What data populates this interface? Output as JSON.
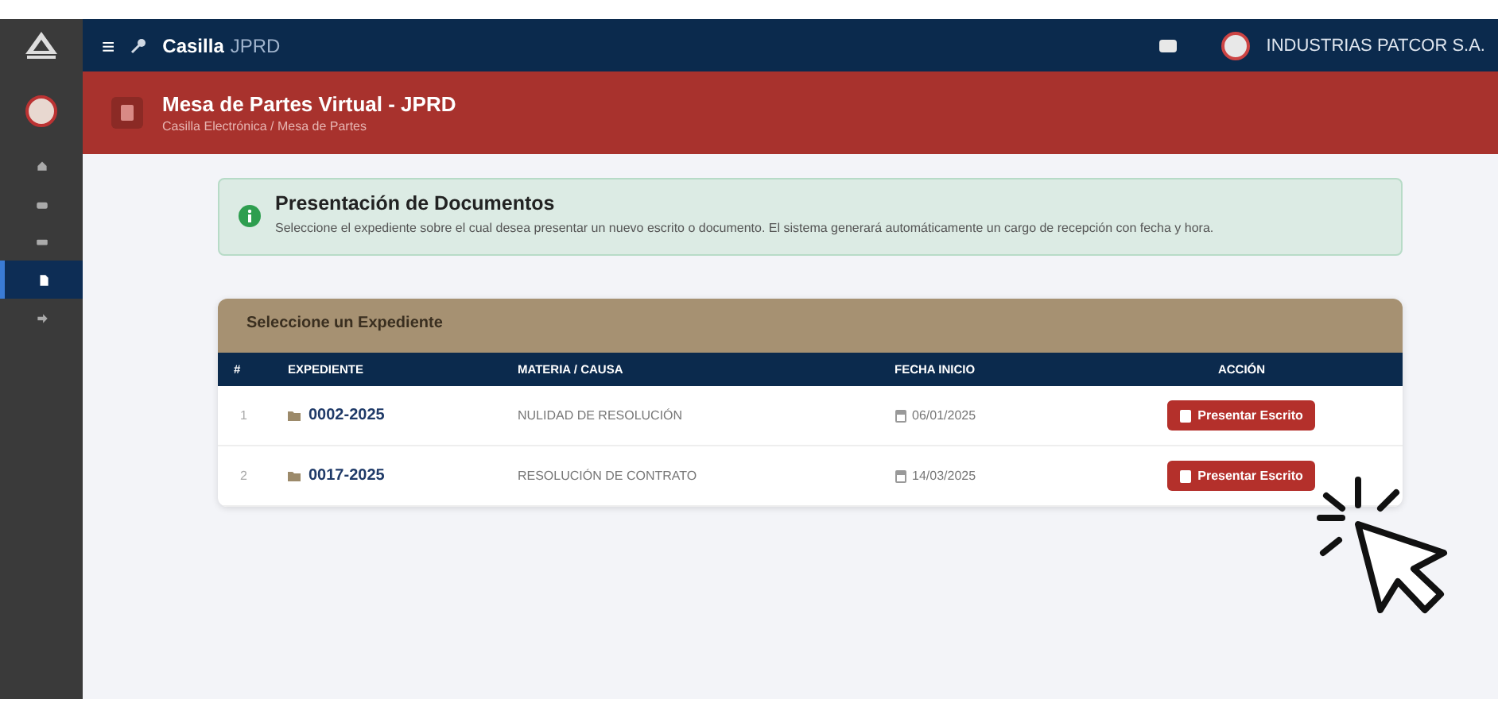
{
  "topbar": {
    "menu_icon": "≡",
    "app_name": "Casilla",
    "app_suffix": "JPRD",
    "user": "INDUSTRIAS PATCOR S.A."
  },
  "sidebar": {
    "items": [
      {
        "selected": false
      },
      {
        "selected": false
      },
      {
        "selected": false
      },
      {
        "selected": true
      },
      {
        "selected": false
      }
    ]
  },
  "header": {
    "title": "Mesa de Partes Virtual - JPRD",
    "breadcrumb": "Casilla Electrónica  /  Mesa de Partes"
  },
  "alert": {
    "title": "Presentación de Documentos",
    "text": "Seleccione el expediente sobre el cual desea presentar un nuevo escrito o documento. El sistema generará automáticamente un cargo de recepción con fecha y hora."
  },
  "table": {
    "title": "Seleccione un Expediente",
    "columns": [
      "#",
      "EXPEDIENTE",
      "MATERIA / CAUSA",
      "FECHA INICIO",
      "ACCIÓN"
    ],
    "rows": [
      {
        "index": "1",
        "expediente": "0002-2025",
        "materia": "NULIDAD DE RESOLUCIÓN",
        "fecha": "06/01/2025",
        "action": "Presentar Escrito"
      },
      {
        "index": "2",
        "expediente": "0017-2025",
        "materia": "RESOLUCIÓN DE CONTRATO",
        "fecha": "14/03/2025",
        "action": "Presentar Escrito"
      }
    ]
  }
}
